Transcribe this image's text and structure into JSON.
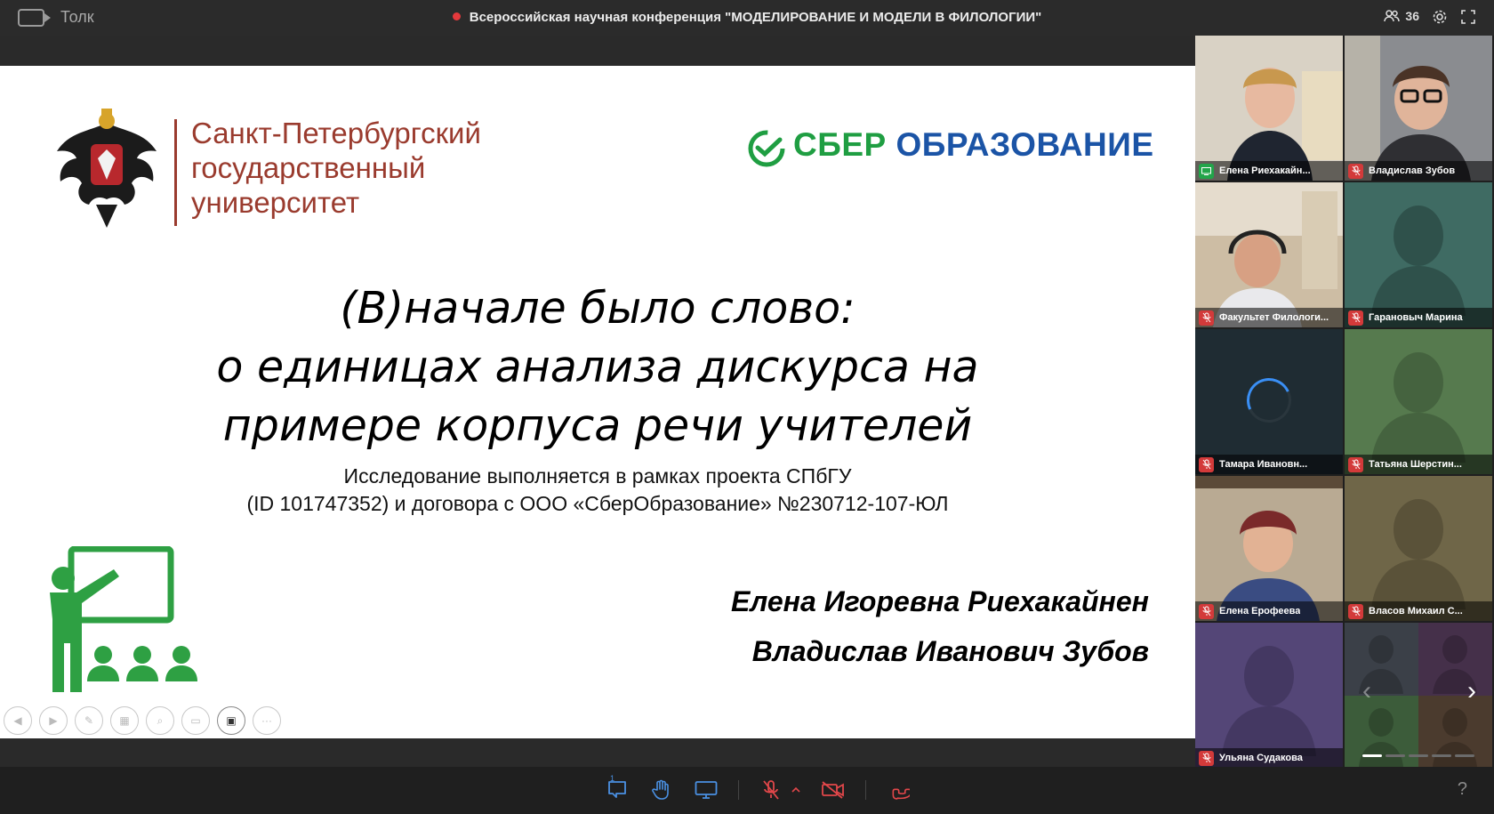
{
  "app": {
    "name": "Толк"
  },
  "header": {
    "conference_title": "Всероссийская научная конференция \"МОДЕЛИРОВАНИЕ И МОДЕЛИ В ФИЛОЛОГИИ\"",
    "participants_count": "36",
    "recording_color": "#e4393c"
  },
  "slide": {
    "university_name": [
      "Санкт-Петербургский",
      "государственный",
      "университет"
    ],
    "university_color": "#9a3b2e",
    "sber": {
      "part1": "СБЕР",
      "part2": "ОБРАЗОВАНИЕ",
      "green": "#1f9e42",
      "blue": "#1b54a6"
    },
    "title_lines": [
      "(В)начале было слово:",
      "о единицах анализа дискурса на",
      "примере корпуса речи учителей"
    ],
    "subtitle_lines": [
      "Исследование выполняется в рамках проекта СПбГУ",
      "(ID 101747352) и договора с ООО «СберОбразование» №230712-107-ЮЛ"
    ],
    "authors": [
      "Елена Игоревна Риехакайнен",
      "Владислав Иванович Зубов"
    ],
    "tools": [
      "prev-icon",
      "next-icon",
      "pen-icon",
      "copy-icon",
      "zoom-icon",
      "subtitles-icon",
      "camera-icon",
      "more-icon"
    ]
  },
  "participants": [
    {
      "name": "Елена Риехакайн...",
      "status": "screen-share",
      "bg": "#cfc7b8"
    },
    {
      "name": "Владислав Зубов",
      "status": "muted",
      "bg": "#7d7f83"
    },
    {
      "name": "Факультет Филологи...",
      "status": "muted",
      "bg": "#c9b89e",
      "active": true
    },
    {
      "name": "Гарановыч Марина",
      "status": "muted",
      "bg": "#3f6b63"
    },
    {
      "name": "Тамара Ивановн...",
      "status": "muted",
      "bg": "#1f2c33"
    },
    {
      "name": "Татьяна Шерстин...",
      "status": "muted",
      "bg": "#567a4e"
    },
    {
      "name": "Елена Ерофеева",
      "status": "muted",
      "bg": "#bdae99"
    },
    {
      "name": "Власов Михаил С...",
      "status": "muted",
      "bg": "#6f6648"
    },
    {
      "name": "Ульяна Судакова",
      "status": "muted",
      "bg": "#544677"
    }
  ],
  "bottom": {
    "reactions_badge": "1",
    "help": "?"
  }
}
